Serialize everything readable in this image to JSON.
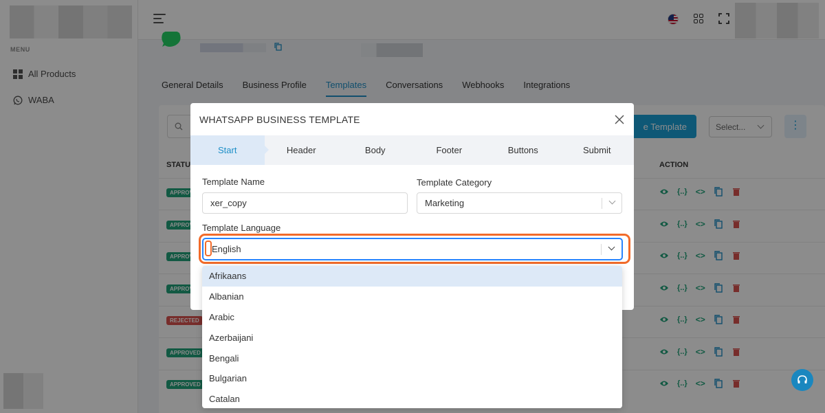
{
  "sidebar": {
    "menu_label": "MENU",
    "items": [
      {
        "label": "All Products",
        "icon": "grid-icon"
      },
      {
        "label": "WABA",
        "icon": "whatsapp-icon"
      }
    ]
  },
  "tabs": [
    "General Details",
    "Business Profile",
    "Templates",
    "Conversations",
    "Webhooks",
    "Integrations"
  ],
  "active_tab": "Templates",
  "toolbar": {
    "create_label": "e Template",
    "select_label": "Select...",
    "more_label": "⋮"
  },
  "table": {
    "status_header": "STATUS",
    "action_header": "ACTION",
    "rows": [
      {
        "status": "APPROVED",
        "kind": "approved"
      },
      {
        "status": "APPROVED",
        "kind": "approved"
      },
      {
        "status": "APPROVED",
        "kind": "approved"
      },
      {
        "status": "APPROVED",
        "kind": "approved"
      },
      {
        "status": "REJECTED",
        "kind": "rejected"
      },
      {
        "status": "APPROVED",
        "kind": "approved"
      },
      {
        "status": "APPROVED",
        "kind": "approved"
      }
    ],
    "action_braces": "{..}",
    "action_code": "<>"
  },
  "modal": {
    "title": "WHATSAPP BUSINESS TEMPLATE",
    "steps": [
      "Start",
      "Header",
      "Body",
      "Footer",
      "Buttons",
      "Submit"
    ],
    "active_step": "Start",
    "template_name_label": "Template Name",
    "template_name_value": "xer_copy",
    "template_category_label": "Template Category",
    "template_category_value": "Marketing",
    "template_language_label": "Template Language",
    "template_language_value": "English",
    "language_options": [
      "Afrikaans",
      "Albanian",
      "Arabic",
      "Azerbaijani",
      "Bengali",
      "Bulgarian",
      "Catalan"
    ],
    "focused_option": "Afrikaans"
  },
  "colors": {
    "accent": "#1e8fc7",
    "approved": "#22a37a",
    "rejected": "#d9534f",
    "highlight": "#f26b2a",
    "focus_ring": "#2684ff"
  }
}
